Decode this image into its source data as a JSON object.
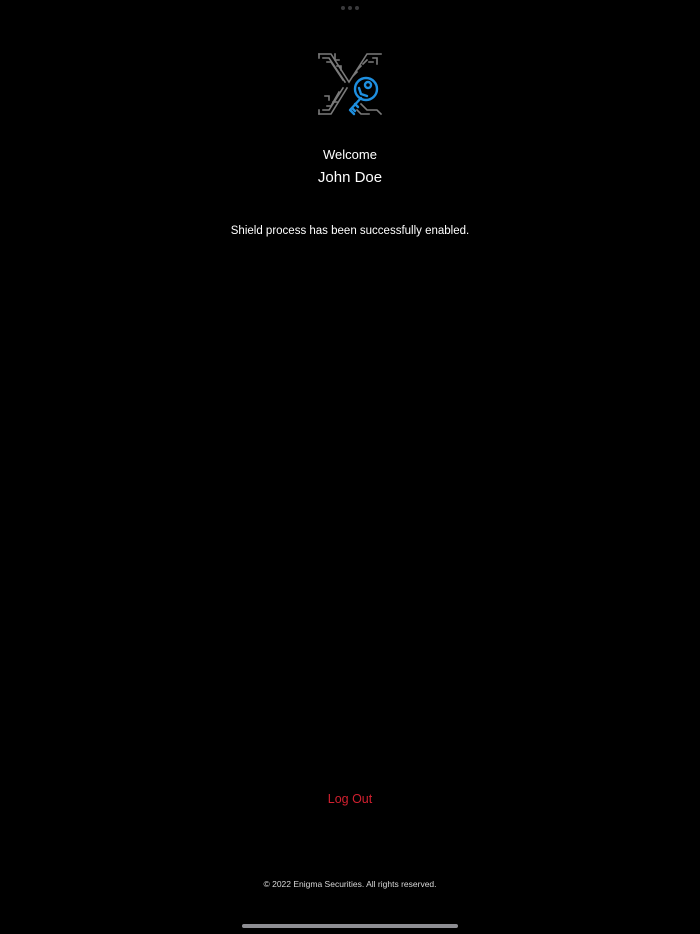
{
  "header": {
    "logo_icon": "x-key-shield-icon",
    "logo_accent_color": "#1e8fe0",
    "logo_gray_color": "#7a7a7a"
  },
  "main": {
    "welcome_label": "Welcome",
    "user_name": "John Doe",
    "status_message": "Shield process has been successfully enabled."
  },
  "actions": {
    "logout_label": "Log Out",
    "logout_color": "#d1202f"
  },
  "footer": {
    "copyright": "© 2022 Enigma Securities. All rights reserved."
  }
}
